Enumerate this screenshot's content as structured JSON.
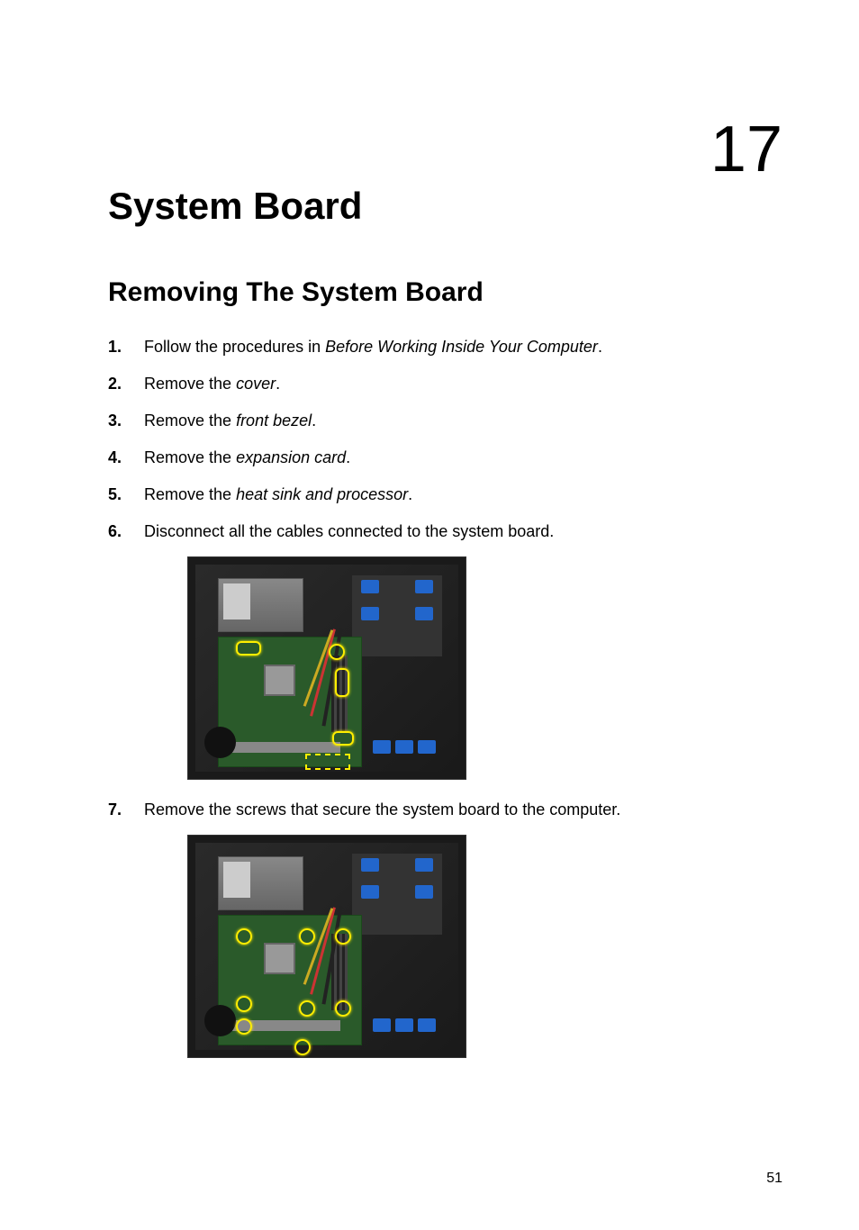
{
  "chapter": {
    "number": "17",
    "title": "System Board"
  },
  "section": {
    "title": "Removing The System Board"
  },
  "steps": [
    {
      "number": "1.",
      "prefix": "Follow the procedures in ",
      "italic": "Before Working Inside Your Computer",
      "suffix": "."
    },
    {
      "number": "2.",
      "prefix": "Remove the ",
      "italic": "cover",
      "suffix": "."
    },
    {
      "number": "3.",
      "prefix": "Remove the ",
      "italic": "front bezel",
      "suffix": "."
    },
    {
      "number": "4.",
      "prefix": "Remove the ",
      "italic": "expansion card",
      "suffix": "."
    },
    {
      "number": "5.",
      "prefix": "Remove the ",
      "italic": "heat sink and processor",
      "suffix": "."
    },
    {
      "number": "6.",
      "prefix": "Disconnect all the cables connected to the system board.",
      "italic": "",
      "suffix": ""
    },
    {
      "number": "7.",
      "prefix": "Remove the screws that secure the system board to the computer.",
      "italic": "",
      "suffix": ""
    }
  ],
  "pageNumber": "51"
}
